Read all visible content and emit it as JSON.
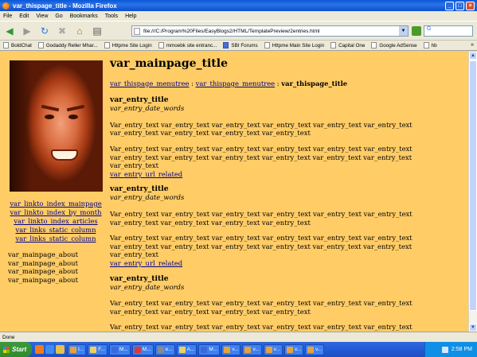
{
  "window": {
    "title": "var_thispage_title - Mozilla Firefox"
  },
  "menu": [
    "File",
    "Edit",
    "View",
    "Go",
    "Bookmarks",
    "Tools",
    "Help"
  ],
  "address": {
    "url": "file:///C:/Program%20Files/EasyBlogs2/HTML/TemplatePreview/2entries.html"
  },
  "bookmarks": [
    "BoldChat",
    "Godaddy Reller Mhar...",
    "Httpme Site Login",
    "mmoebk site entranc...",
    "SBI Forums",
    "Httpme Main Site Login",
    "Capital One",
    "Google AdSense",
    "hb"
  ],
  "page": {
    "title": "var_mainpage_title",
    "breadcrumb": {
      "link1": "var_thispage_menutree",
      "link2": "var_thispage_menutree",
      "sep": " : ",
      "current": "var_thispage_title"
    },
    "side_links": [
      "var_linkto_index_mainpage",
      "var_linkto_index_by_month",
      "var_linkto_index_articles",
      "var_links_static_column",
      "var_links_static_column"
    ],
    "about": [
      "var_mainpage_about",
      "var_mainpage_about",
      "var_mainpage_about",
      "var_mainpage_about"
    ],
    "entries": [
      {
        "title": "var_entry_title",
        "date": "var_entry_date_words",
        "p1": "Var_entry_text var_entry_text var_entry_text var_entry_text var_entry_text var_entry_text var_entry_text var_entry_text var_entry_text var_entry_text",
        "p2": "Var_entry_text var_entry_text var_entry_text var_entry_text var_entry_text var_entry_text var_entry_text var_entry_text var_entry_text var_entry_text var_entry_text var_entry_text var_entry_text",
        "link": "var_entry_url_related"
      },
      {
        "title": "var_entry_title",
        "date": "var_entry_date_words",
        "p1": "Var_entry_text var_entry_text var_entry_text var_entry_text var_entry_text var_entry_text var_entry_text var_entry_text var_entry_text var_entry_text",
        "p2": "Var_entry_text var_entry_text var_entry_text var_entry_text var_entry_text var_entry_text var_entry_text var_entry_text var_entry_text var_entry_text var_entry_text var_entry_text var_entry_text",
        "link": "var_entry_url_related"
      },
      {
        "title": "var_entry_title",
        "date": "var_entry_date_words",
        "p1": "Var_entry_text var_entry_text var_entry_text var_entry_text var_entry_text var_entry_text var_entry_text var_entry_text var_entry_text var_entry_text",
        "p2": "Var_entry_text var_entry_text var_entry_text var_entry_text var_entry_text var_entry_text var_entry_text var_entry_text var_entry_text var_entry_text var_entry_text var_entry_text var_entry_text",
        "link": "var_entry_url_related"
      }
    ]
  },
  "status": {
    "text": "Done"
  },
  "taskbar": {
    "start_label": "Start",
    "tasks": [
      "I...",
      "F...",
      "M...",
      "M...",
      "e...",
      "A...",
      "M...",
      "v...",
      "v...",
      "v...",
      "v...",
      "v...",
      "v...",
      "v...",
      "v..."
    ],
    "clock": "2:58 PM"
  },
  "colors": {
    "page_bg": "#ffcc66",
    "link": "#00008b"
  },
  "icons": [
    "firefox-icon",
    "back-icon",
    "forward-icon",
    "reload-icon",
    "stop-icon",
    "home-icon",
    "print-icon",
    "go-icon",
    "search-icon"
  ]
}
